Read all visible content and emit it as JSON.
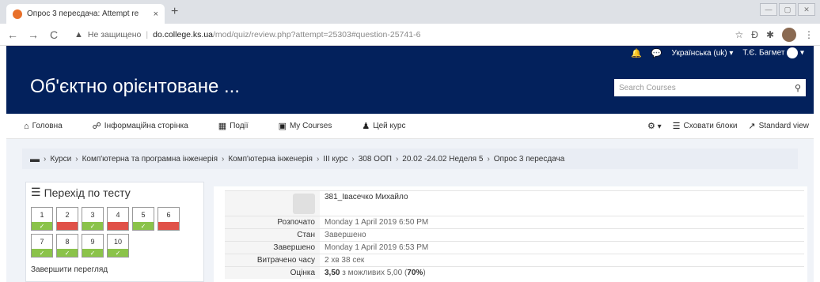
{
  "browser": {
    "tab_title": "Опрос 3 пересдача: Attempt re",
    "tab_close": "×",
    "new_tab": "+",
    "win_minimize": "—",
    "win_restore": "▢",
    "win_close": "✕",
    "nav_back": "←",
    "nav_forward": "→",
    "nav_reload": "C",
    "warn_icon": "▲",
    "insecure_label": "Не защищено",
    "url_separator": "|",
    "url_host": "do.college.ks.ua",
    "url_path": "/mod/quiz/review.php?attempt=25303#question-25741-6",
    "star": "☆",
    "ext_icon_1": "Ð",
    "ext_icon_2": "✱",
    "menu_dots": "⋮"
  },
  "topnav": {
    "bell": "🔔",
    "message": "💬",
    "language": "Українська (uk) ▾",
    "user_name": "Т.Є. Багмет",
    "user_caret": "▾"
  },
  "header": {
    "course_title": "Об'єктно орієнтоване ...",
    "search_placeholder": "Search Courses",
    "search_icon": "⚲"
  },
  "menu": {
    "items": [
      {
        "icon": "⌂",
        "label": "Головна"
      },
      {
        "icon": "☍",
        "label": "Інформаційна сторінка"
      },
      {
        "icon": "▦",
        "label": "Події"
      },
      {
        "icon": "▣",
        "label": "My Courses"
      },
      {
        "icon": "♟",
        "label": "Цей курс"
      }
    ],
    "gear": "⚙",
    "gear_caret": "▾",
    "hide_blocks_icon": "☰",
    "hide_blocks": "Сховати блоки",
    "standard_view_icon": "↗",
    "standard_view": "Standard view"
  },
  "breadcrumb": {
    "folder_icon": "▬",
    "sep": "›",
    "items": [
      "Курси",
      "Комп'ютерна та програмна інженерія",
      "Комп'ютерна інженерія",
      "III курс",
      "308 ООП",
      "20.02 -24.02 Неделя 5",
      "Опрос 3 пересдача"
    ]
  },
  "quiz_nav": {
    "title_icon": "☰",
    "title": "Перехід по тесту",
    "questions": [
      {
        "num": "1",
        "status": "correct",
        "mark": "✓"
      },
      {
        "num": "2",
        "status": "wrong",
        "mark": ""
      },
      {
        "num": "3",
        "status": "correct",
        "mark": "✓"
      },
      {
        "num": "4",
        "status": "wrong",
        "mark": ""
      },
      {
        "num": "5",
        "status": "correct",
        "mark": "✓"
      },
      {
        "num": "6",
        "status": "wrong",
        "mark": ""
      },
      {
        "num": "7",
        "status": "correct",
        "mark": "✓"
      },
      {
        "num": "8",
        "status": "correct",
        "mark": "✓"
      },
      {
        "num": "9",
        "status": "correct",
        "mark": "✓"
      },
      {
        "num": "10",
        "status": "correct",
        "mark": "✓"
      }
    ],
    "finish_review": "Завершити перегляд"
  },
  "review": {
    "user": "381_Івасечко Михайло",
    "rows": [
      {
        "label": "Розпочато",
        "value": "Monday 1 April 2019 6:50 PM"
      },
      {
        "label": "Стан",
        "value": "Завершено"
      },
      {
        "label": "Завершено",
        "value": "Monday 1 April 2019 6:53 PM"
      },
      {
        "label": "Витрачено часу",
        "value": "2 хв 38 сек"
      }
    ],
    "grade_label": "Оцінка",
    "grade_value": "3,50",
    "grade_mid": " з можливих 5,00 (",
    "grade_percent": "70%",
    "grade_end": ")"
  },
  "colors": {
    "brand_navy": "#03215c",
    "correct_green": "#8bc34a",
    "wrong_red": "#e05148"
  }
}
